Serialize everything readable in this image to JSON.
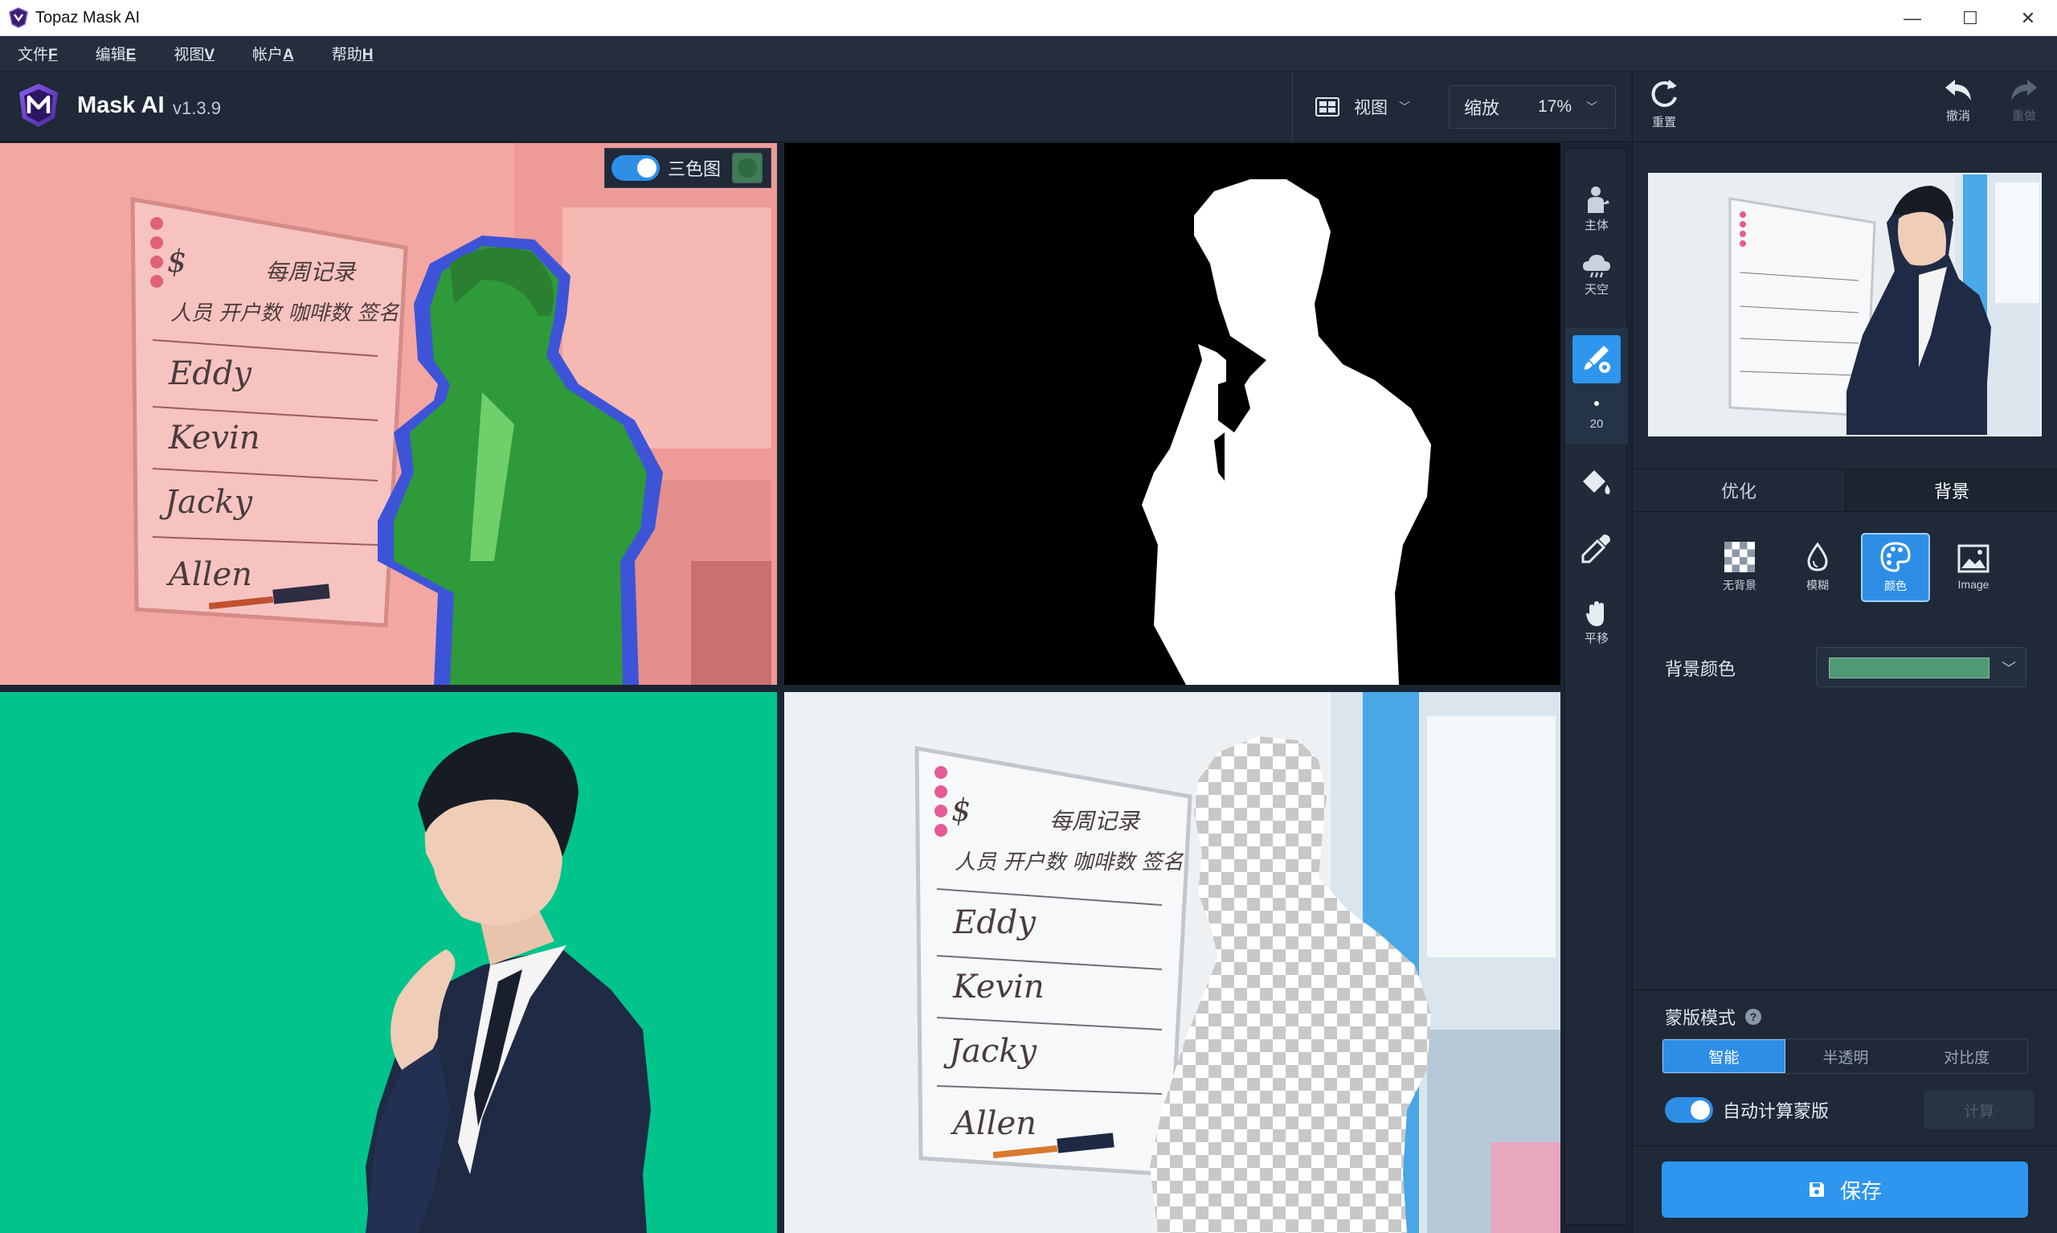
{
  "window": {
    "title": "Topaz Mask AI",
    "minimize": "—",
    "maximize": "☐",
    "close": "✕"
  },
  "menu": [
    {
      "label": "文件",
      "accel": "F"
    },
    {
      "label": "编辑",
      "accel": "E"
    },
    {
      "label": "视图",
      "accel": "V"
    },
    {
      "label": "帐户",
      "accel": "A"
    },
    {
      "label": "帮助",
      "accel": "H"
    }
  ],
  "header": {
    "app_name": "Mask AI",
    "version": "v1.3.9",
    "view_label": "视图",
    "zoom_label": "缩放",
    "zoom_value": "17%"
  },
  "right_top": {
    "reset": "重置",
    "undo": "撤消",
    "redo": "重做"
  },
  "tools": {
    "subject": "主体",
    "sky": "天空",
    "brush_size": "20",
    "pan": "平移"
  },
  "trimap": {
    "label": "三色图"
  },
  "whiteboard": {
    "title": "每周记录",
    "header": "人员  开户数  咖啡数  签名",
    "names": [
      "Eddy",
      "Kevin",
      "Jacky",
      "Allen"
    ],
    "symbol": "$"
  },
  "tabs": {
    "optimize": "优化",
    "background": "背景"
  },
  "background_options": [
    {
      "label": "无背景",
      "icon": "checker-icon"
    },
    {
      "label": "模糊",
      "icon": "drop-icon"
    },
    {
      "label": "颜色",
      "icon": "palette-icon",
      "active": true
    },
    {
      "label": "Image",
      "icon": "image-icon"
    }
  ],
  "bg_color": {
    "label": "背景颜色",
    "value": "#4f9a74"
  },
  "mask_mode": {
    "label": "蒙版模式",
    "help": "?",
    "options": [
      "智能",
      "半透明",
      "对比度"
    ],
    "active": "智能"
  },
  "auto_mask": {
    "label": "自动计算蒙版",
    "calc_label": "计算"
  },
  "save": {
    "label": "保存"
  },
  "colors": {
    "accent": "#2e96ee",
    "panel": "#1f2937",
    "trimap_bg": "#f3a7a2",
    "trimap_fg": "#2f9a3a",
    "trimap_edge": "#3d54d8",
    "green_screen": "#00c48b"
  }
}
